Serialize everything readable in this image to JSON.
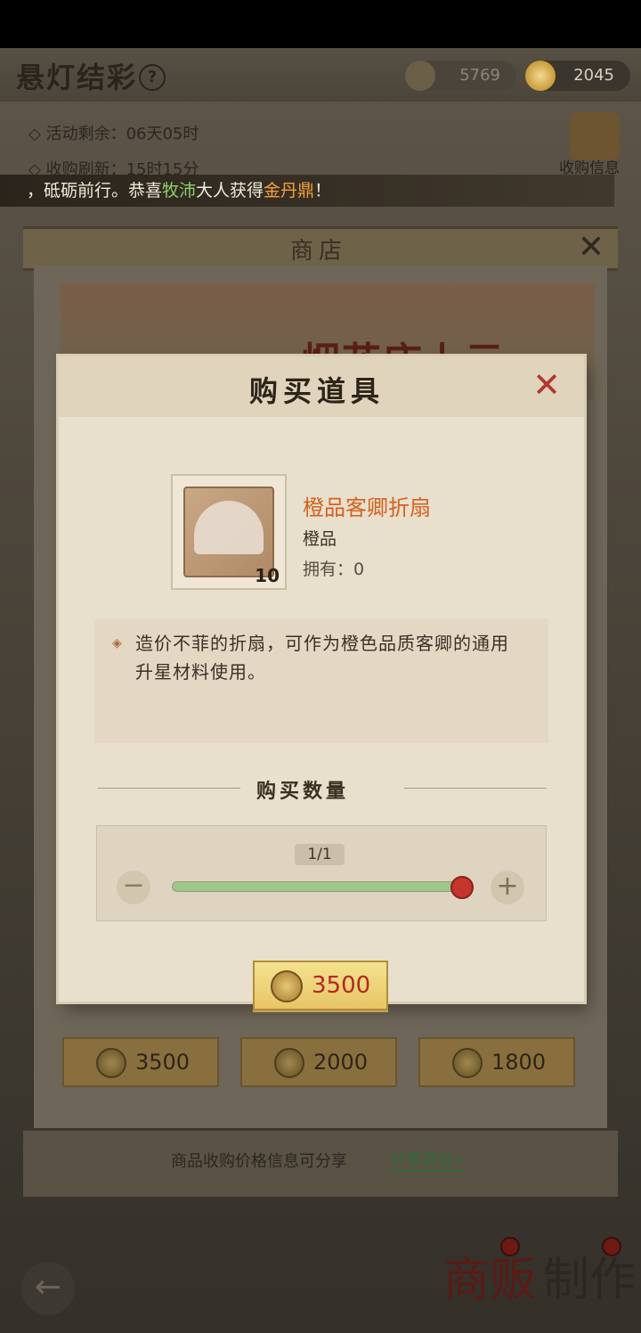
{
  "header": {
    "title": "悬灯结彩",
    "help_icon": "?"
  },
  "resources": {
    "silver_value": "5769",
    "gold_value": "2045"
  },
  "info": {
    "activity_remaining": "◇ 活动剩余：06天05时",
    "purchase_refresh": "◇ 收购刷新：15时15分",
    "collect_label": "收购信息"
  },
  "news": {
    "prefix": "，砥砺前行。恭喜",
    "player": "牧沛",
    "middle": "大人获得",
    "reward": "金丹鼎",
    "suffix": "！"
  },
  "shop": {
    "title": "商店",
    "close_glyph": "✕",
    "banner_text": "烟花庆上元",
    "prices": [
      "3500",
      "2000",
      "1800"
    ],
    "footer_text": "商品收购价格信息可分享",
    "share_link": "分享商品»"
  },
  "bottom": {
    "back_glyph": "←",
    "trade_tab": "商贩",
    "make_tab": "制作"
  },
  "dialog": {
    "title": "购买道具",
    "close_glyph": "✕",
    "item": {
      "name": "橙品客卿折扇",
      "grade": "橙品",
      "owned": "拥有：0",
      "count": "10"
    },
    "description": "造价不菲的折扇，可作为橙色品质客卿的通用升星材料使用。",
    "diamond_glyph": "◈",
    "quantity": {
      "title": "购买数量",
      "display": "1/1",
      "current": 1,
      "max": 1,
      "minus_glyph": "−",
      "plus_glyph": "+"
    },
    "buy_price": "3500"
  },
  "colors": {
    "accent_orange": "#d2621f",
    "price_red": "#b3281f",
    "slider_green": "#9cc88a",
    "thumb_red": "#c4352b",
    "news_green": "#8fd06b",
    "news_orange": "#f5a13a"
  }
}
